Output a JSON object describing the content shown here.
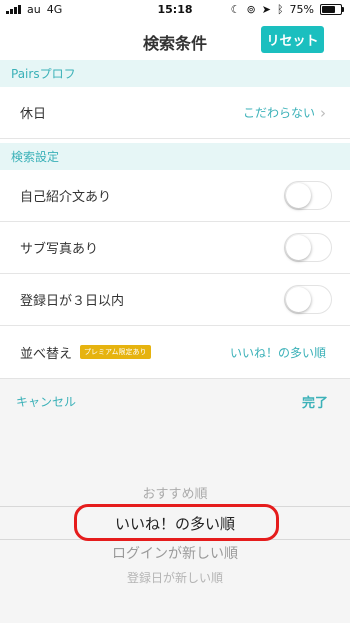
{
  "status_bar": {
    "carrier": "au",
    "network": "4G",
    "time": "15:18",
    "battery": "75%",
    "battery_level": 0.75
  },
  "nav": {
    "title": "検索条件",
    "reset_label": "リセット"
  },
  "sections": {
    "pairs_profile": {
      "header": "Pairsプロフ",
      "holiday_label": "休日",
      "holiday_value": "こだわらない"
    },
    "search_settings": {
      "header": "検索設定",
      "self_intro_label": "自己紹介文あり",
      "self_intro_on": false,
      "sub_photo_label": "サブ写真あり",
      "sub_photo_on": false,
      "registered_label": "登録日が３日以内",
      "registered_on": false,
      "sort_label": "並べ替え",
      "sort_badge": "プレミアム限定あり",
      "sort_value": "いいね！の多い順"
    }
  },
  "picker": {
    "cancel_label": "キャンセル",
    "done_label": "完了",
    "options": [
      "おすすめ順",
      "いいね！の多い順",
      "ログインが新しい順",
      "登録日が新しい順"
    ],
    "selected_index": 1
  },
  "colors": {
    "accent": "#1bbfbf",
    "section_bg": "#e6f6f6",
    "badge": "#e6b30f",
    "highlight": "#e51c1c"
  }
}
